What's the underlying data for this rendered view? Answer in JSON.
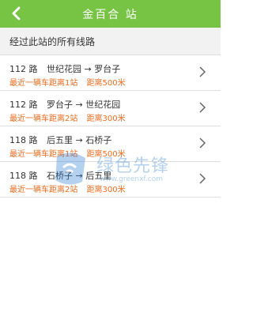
{
  "header": {
    "title": "金百合 站"
  },
  "subheader": {
    "label": "经过此站的所有线路"
  },
  "routes": [
    {
      "number": "112 路",
      "from": "世纪花园",
      "arrow": "→",
      "to": "罗台子",
      "nearest": "最近一辆车距离1站",
      "distance": "距离500米"
    },
    {
      "number": "112 路",
      "from": "罗台子",
      "arrow": "→",
      "to": "世纪花园",
      "nearest": "最近一辆车距离2站",
      "distance": "距离300米"
    },
    {
      "number": "118 路",
      "from": "后五里",
      "arrow": "→",
      "to": "石桥子",
      "nearest": "最近一辆车距离1站",
      "distance": "距离500米"
    },
    {
      "number": "118 路",
      "from": "石桥子",
      "arrow": "→",
      "to": "后五里",
      "nearest": "最近一辆车距离2站",
      "distance": "距离300米"
    }
  ],
  "watermark": {
    "brand": "绿色先锋",
    "url": "www.greenxf.com"
  },
  "colors": {
    "header_bg": "#77c344",
    "info_text": "#f26a1b"
  }
}
